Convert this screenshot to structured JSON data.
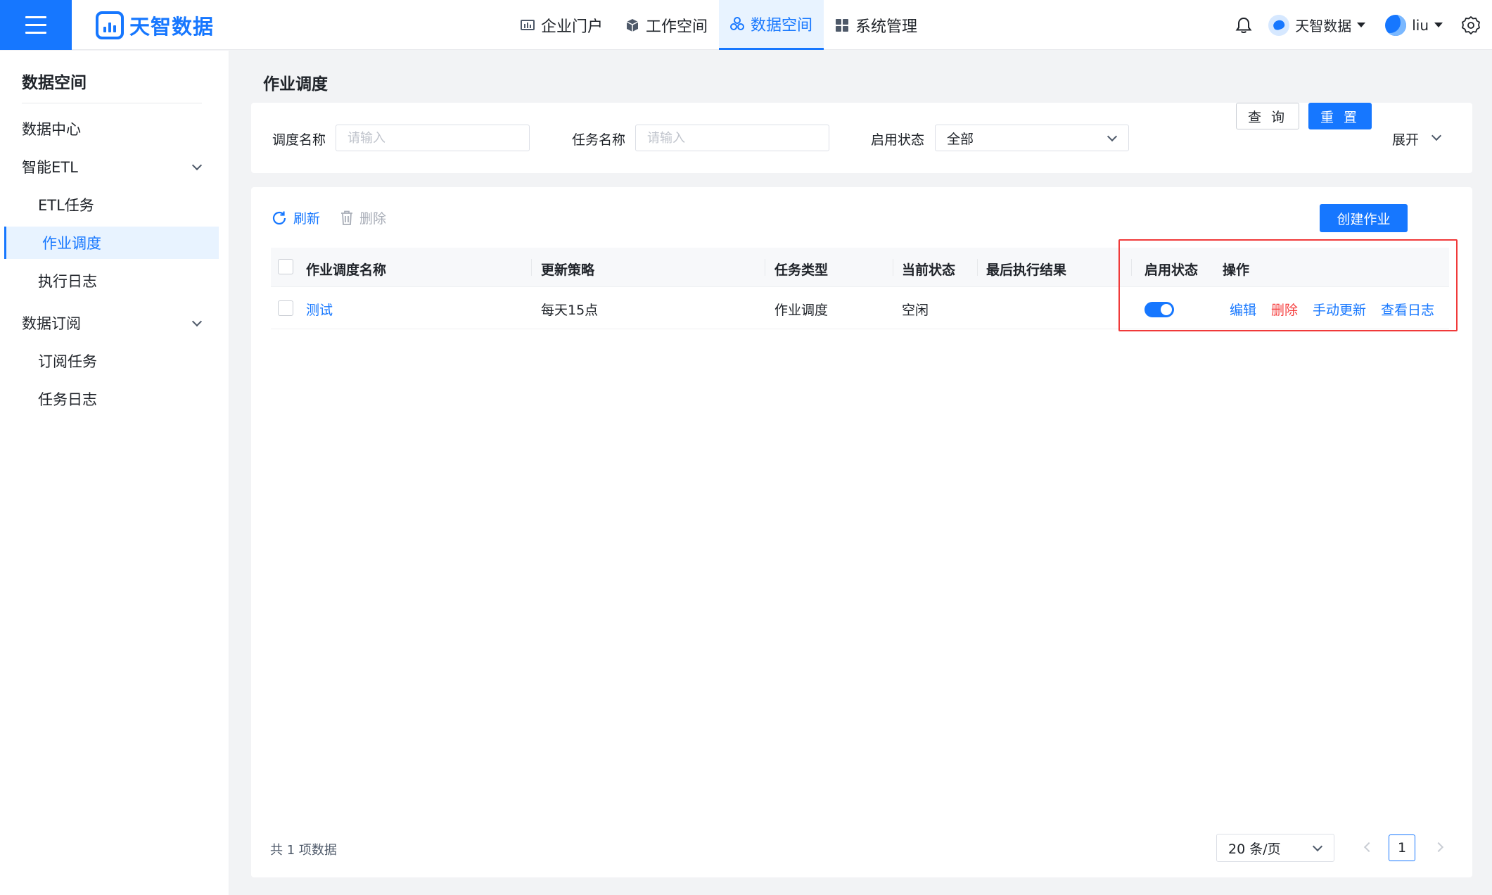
{
  "header": {
    "logo_text": "天智数据",
    "nav": [
      {
        "label": "企业门户",
        "icon": "chart-icon"
      },
      {
        "label": "工作空间",
        "icon": "cube-icon"
      },
      {
        "label": "数据空间",
        "icon": "cluster-icon",
        "active": true
      },
      {
        "label": "系统管理",
        "icon": "apps-icon"
      }
    ],
    "workspace": "天智数据",
    "user": "liu"
  },
  "sidebar": {
    "title": "数据空间",
    "items": [
      {
        "label": "数据中心"
      },
      {
        "label": "智能ETL"
      },
      {
        "label": "ETL任务"
      },
      {
        "label": "作业调度",
        "active": true
      },
      {
        "label": "执行日志"
      },
      {
        "label": "数据订阅"
      },
      {
        "label": "订阅任务"
      },
      {
        "label": "任务日志"
      }
    ]
  },
  "page": {
    "title": "作业调度"
  },
  "filters": {
    "schedule_name_label": "调度名称",
    "schedule_name_placeholder": "请输入",
    "task_name_label": "任务名称",
    "task_name_placeholder": "请输入",
    "status_label": "启用状态",
    "status_value": "全部",
    "query_button": "查 询",
    "reset_button": "重 置",
    "expand_label": "展开"
  },
  "toolbar": {
    "refresh": "刷新",
    "delete": "删除",
    "create": "创建作业"
  },
  "table": {
    "columns": [
      "作业调度名称",
      "更新策略",
      "任务类型",
      "当前状态",
      "最后执行结果",
      "启用状态",
      "操作"
    ],
    "rows": [
      {
        "name": "测试",
        "strategy": "每天15点",
        "task_type": "作业调度",
        "current_status": "空闲",
        "last_result": "",
        "enabled": true,
        "actions": [
          "编辑",
          "删除",
          "手动更新",
          "查看日志"
        ]
      }
    ]
  },
  "pagination": {
    "total_text": "共 1 项数据",
    "page_size": "20 条/页",
    "current_page": "1"
  },
  "colors": {
    "primary": "#1677ff",
    "danger": "#f53f3f",
    "highlight_box": "#f03a3a"
  }
}
